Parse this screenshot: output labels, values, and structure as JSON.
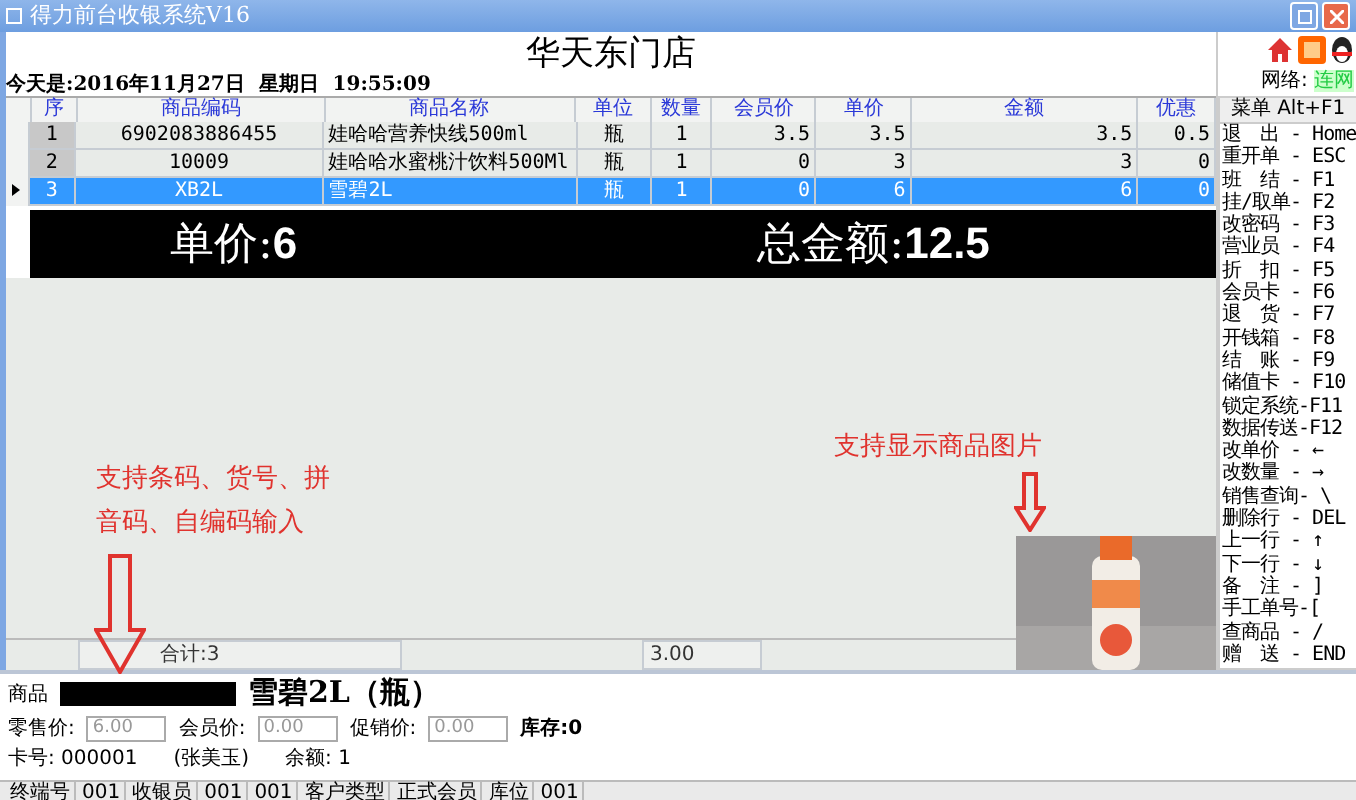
{
  "window": {
    "title": "得力前台收银系统V16"
  },
  "header": {
    "store_name": "华天东门店",
    "date": "今天是:2016年11月27日  星期日  19:55:09",
    "network_label": "网络:",
    "network_status": "连网"
  },
  "table": {
    "columns": [
      "序",
      "商品编码",
      "商品名称",
      "单位",
      "数量",
      "会员价",
      "单价",
      "金额",
      "优惠"
    ],
    "rows": [
      {
        "cells": [
          "1",
          "6902083886455",
          "娃哈哈营养快线500ml",
          "瓶",
          "1",
          "3.5",
          "3.5",
          "3.5",
          "0.5"
        ],
        "selected": false
      },
      {
        "cells": [
          "2",
          "10009",
          "娃哈哈水蜜桃汁饮料500Ml",
          "瓶",
          "1",
          "0",
          "3",
          "3",
          "0"
        ],
        "selected": false
      },
      {
        "cells": [
          "3",
          "XB2L",
          "雪碧2L",
          "瓶",
          "1",
          "0",
          "6",
          "6",
          "0"
        ],
        "selected": true
      }
    ]
  },
  "display": {
    "price_label": "单价:",
    "price_value": "6",
    "total_label": "总金额:",
    "total_value": "12.5"
  },
  "annotations": [
    {
      "text": "支持条码、货号、拼音码、自编码输入"
    },
    {
      "text": "支持显示商品图片"
    }
  ],
  "totals": {
    "count": "合计:3",
    "amount": "3.00"
  },
  "menu": {
    "title": "菜单 Alt+F1",
    "items": [
      "退　出 - Home",
      "重开单 - ESC",
      "班　结 - F1",
      "挂/取单- F2",
      "改密码 - F3",
      "营业员 - F4",
      "折　扣 - F5",
      "会员卡 - F6",
      "退　货 - F7",
      "开钱箱 - F8",
      "结　账 - F9",
      "储值卡 - F10",
      "锁定系统-F11",
      "数据传送-F12",
      "改单价 - ←",
      "改数量 - →",
      "销售查询- \\",
      "删除行 - DEL",
      "上一行 - ↑",
      "下一行 - ↓",
      "备　注 - ]",
      "手工单号-[",
      "查商品 - /",
      "赠　送 - END"
    ]
  },
  "product": {
    "label": "商品",
    "name": "雪碧2L（瓶）",
    "fields": [
      {
        "label": "零售价:",
        "value": "6.00"
      },
      {
        "label": "会员价:",
        "value": "0.00"
      },
      {
        "label": "促销价:",
        "value": "0.00"
      }
    ],
    "stock": "库存:0",
    "card": "卡号: 000001",
    "member": "(张美玉)",
    "balance": "余额: 1"
  },
  "status_bar": [
    "终端号",
    "001",
    "收银员",
    "001",
    "001",
    "客户类型",
    "正式会员",
    "库位",
    "001"
  ]
}
